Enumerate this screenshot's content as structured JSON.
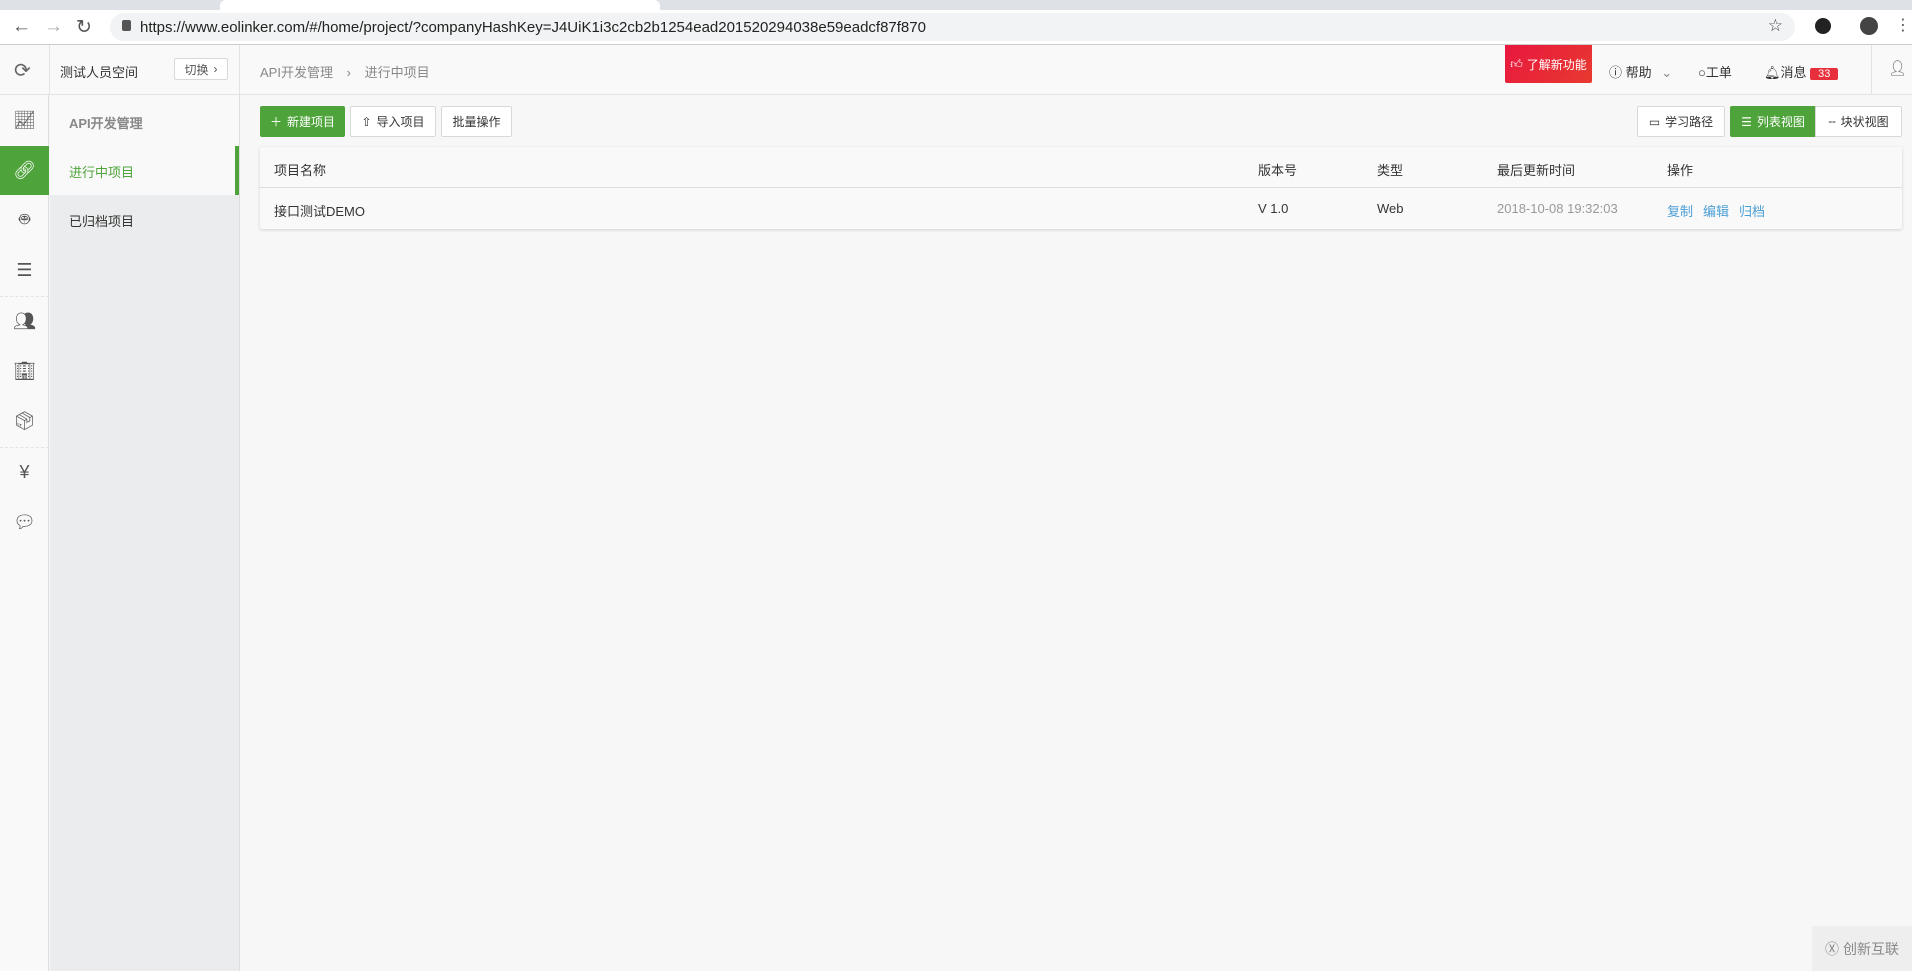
{
  "browser": {
    "url": "https://www.eolinker.com/#/home/project/?companyHashKey=J4UiK1i3c2cb2b1254ead201520294038e59eadcf87f870"
  },
  "header": {
    "workspace": "测试人员空间",
    "switch_label": "切换",
    "breadcrumb": [
      "API开发管理",
      "进行中项目"
    ],
    "new_features": "了解新功能",
    "help": "帮助",
    "tickets": "工单",
    "messages": "消息",
    "message_count": "33"
  },
  "sidebar": {
    "title": "API开发管理",
    "items": [
      {
        "label": "进行中项目",
        "active": true
      },
      {
        "label": "已归档项目",
        "active": false
      }
    ]
  },
  "toolbar": {
    "new_project": "新建项目",
    "import_project": "导入项目",
    "batch": "批量操作",
    "learning_path": "学习路径",
    "list_view": "列表视图",
    "block_view": "块状视图"
  },
  "table": {
    "headers": [
      "项目名称",
      "版本号",
      "类型",
      "最后更新时间",
      "操作"
    ],
    "rows": [
      {
        "name": "接口测试DEMO",
        "version": "V 1.0",
        "type": "Web",
        "updated": "2018-10-08 19:32:03",
        "actions": [
          "复制",
          "编辑",
          "归档"
        ]
      }
    ]
  },
  "watermark": "创新互联",
  "colors": {
    "accent": "#4ea33b",
    "badge": "#e8303c",
    "link": "#4a9fd5"
  }
}
